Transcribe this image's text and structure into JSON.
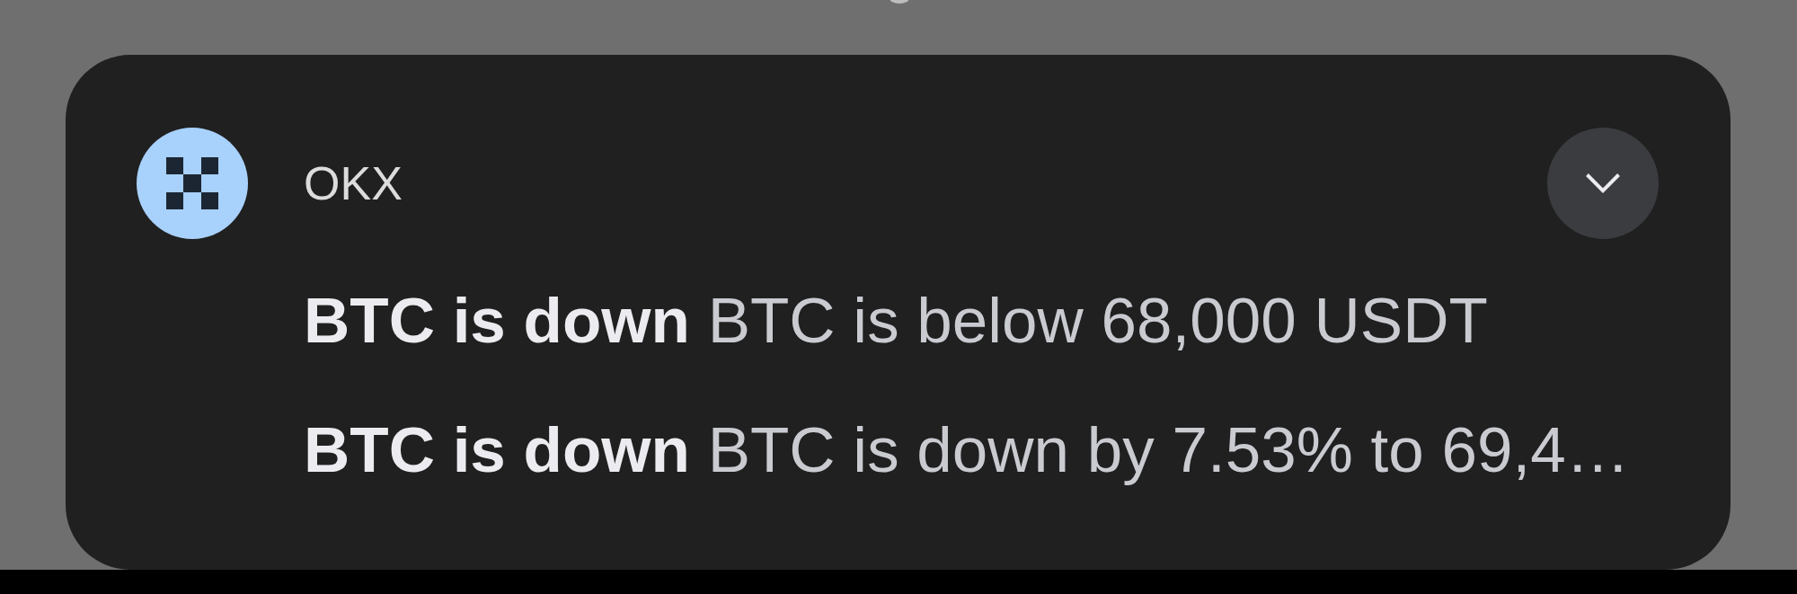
{
  "notification": {
    "app_name": "OKX",
    "expanded": false,
    "messages": [
      {
        "text": "**BTC is down** BTC is below 68,000 USDT"
      },
      {
        "text": "**BTC is down** BTC is down by 7.53% to 69,4…"
      }
    ]
  }
}
